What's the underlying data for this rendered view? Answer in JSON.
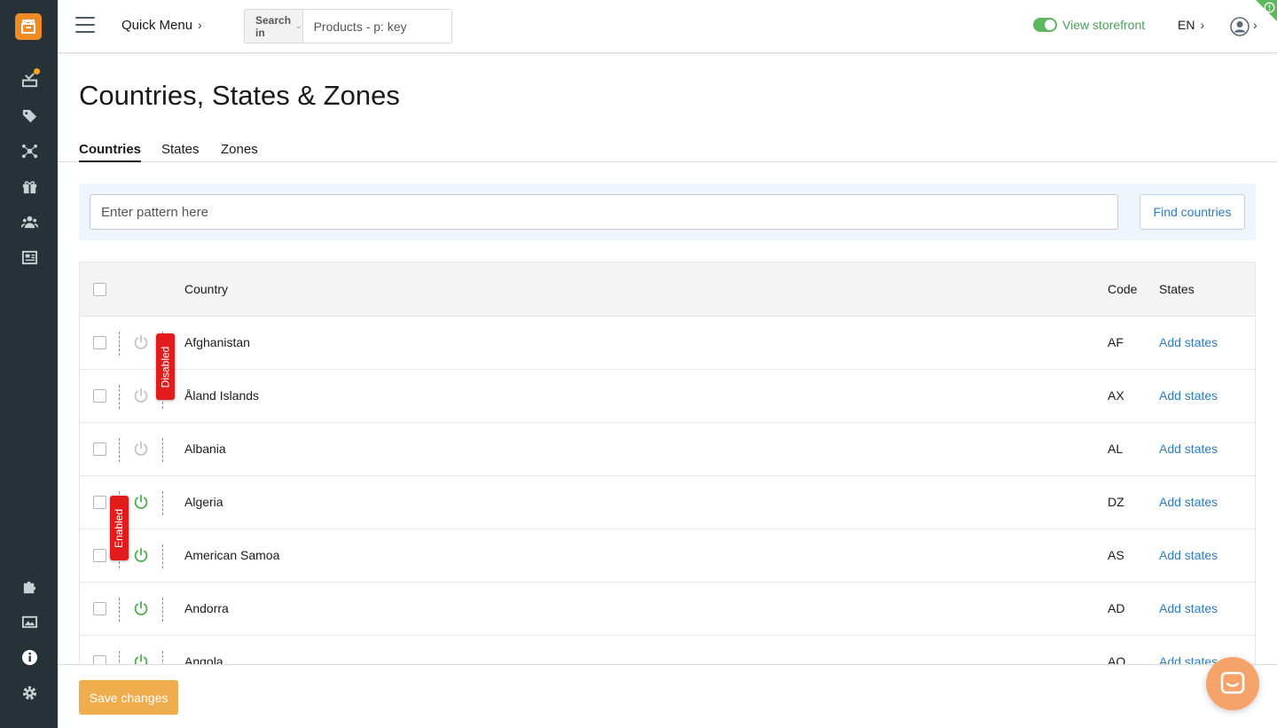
{
  "topbar": {
    "quick_menu": "Quick Menu",
    "chevron": "›",
    "search_in": "Search in",
    "search_placeholder": "Products - p: key",
    "storefront": "View storefront",
    "language": "EN"
  },
  "sidebar": {
    "items": [
      {
        "icon": "orders-icon"
      },
      {
        "icon": "tags-icon"
      },
      {
        "icon": "hub-icon"
      },
      {
        "icon": "gift-icon"
      },
      {
        "icon": "users-icon"
      },
      {
        "icon": "news-icon"
      },
      {
        "icon": "puzzle-icon"
      },
      {
        "icon": "image-icon"
      },
      {
        "icon": "info-icon"
      },
      {
        "icon": "gear-icon"
      }
    ]
  },
  "page": {
    "title": "Countries, States & Zones",
    "tabs": [
      "Countries",
      "States",
      "Zones"
    ]
  },
  "filter": {
    "placeholder": "Enter pattern here",
    "button": "Find countries"
  },
  "table": {
    "headers": {
      "country": "Country",
      "code": "Code",
      "states": "States"
    },
    "rows": [
      {
        "country": "Afghanistan",
        "code": "AF",
        "states": "Add states",
        "status": "disabled"
      },
      {
        "country": "Åland Islands",
        "code": "AX",
        "states": "Add states",
        "status": "disabled"
      },
      {
        "country": "Albania",
        "code": "AL",
        "states": "Add states",
        "status": "disabled"
      },
      {
        "country": "Algeria",
        "code": "DZ",
        "states": "Add states",
        "status": "enabled"
      },
      {
        "country": "American Samoa",
        "code": "AS",
        "states": "Add states",
        "status": "enabled"
      },
      {
        "country": "Andorra",
        "code": "AD",
        "states": "Add states",
        "status": "enabled"
      },
      {
        "country": "Angola",
        "code": "AO",
        "states": "Add states",
        "status": "enabled"
      }
    ]
  },
  "tooltips": {
    "disabled": "Disabled",
    "enabled": "Enabled"
  },
  "footer": {
    "save": "Save changes"
  },
  "colors": {
    "sidebar_bg": "#263238",
    "brand_orange": "#f08a24",
    "link_blue": "#2d7cbf",
    "enabled_green": "#4caf50",
    "disabled_gray": "#c4c4c4",
    "tooltip_red": "#e21c1c",
    "save_button": "#f0ad4e"
  }
}
